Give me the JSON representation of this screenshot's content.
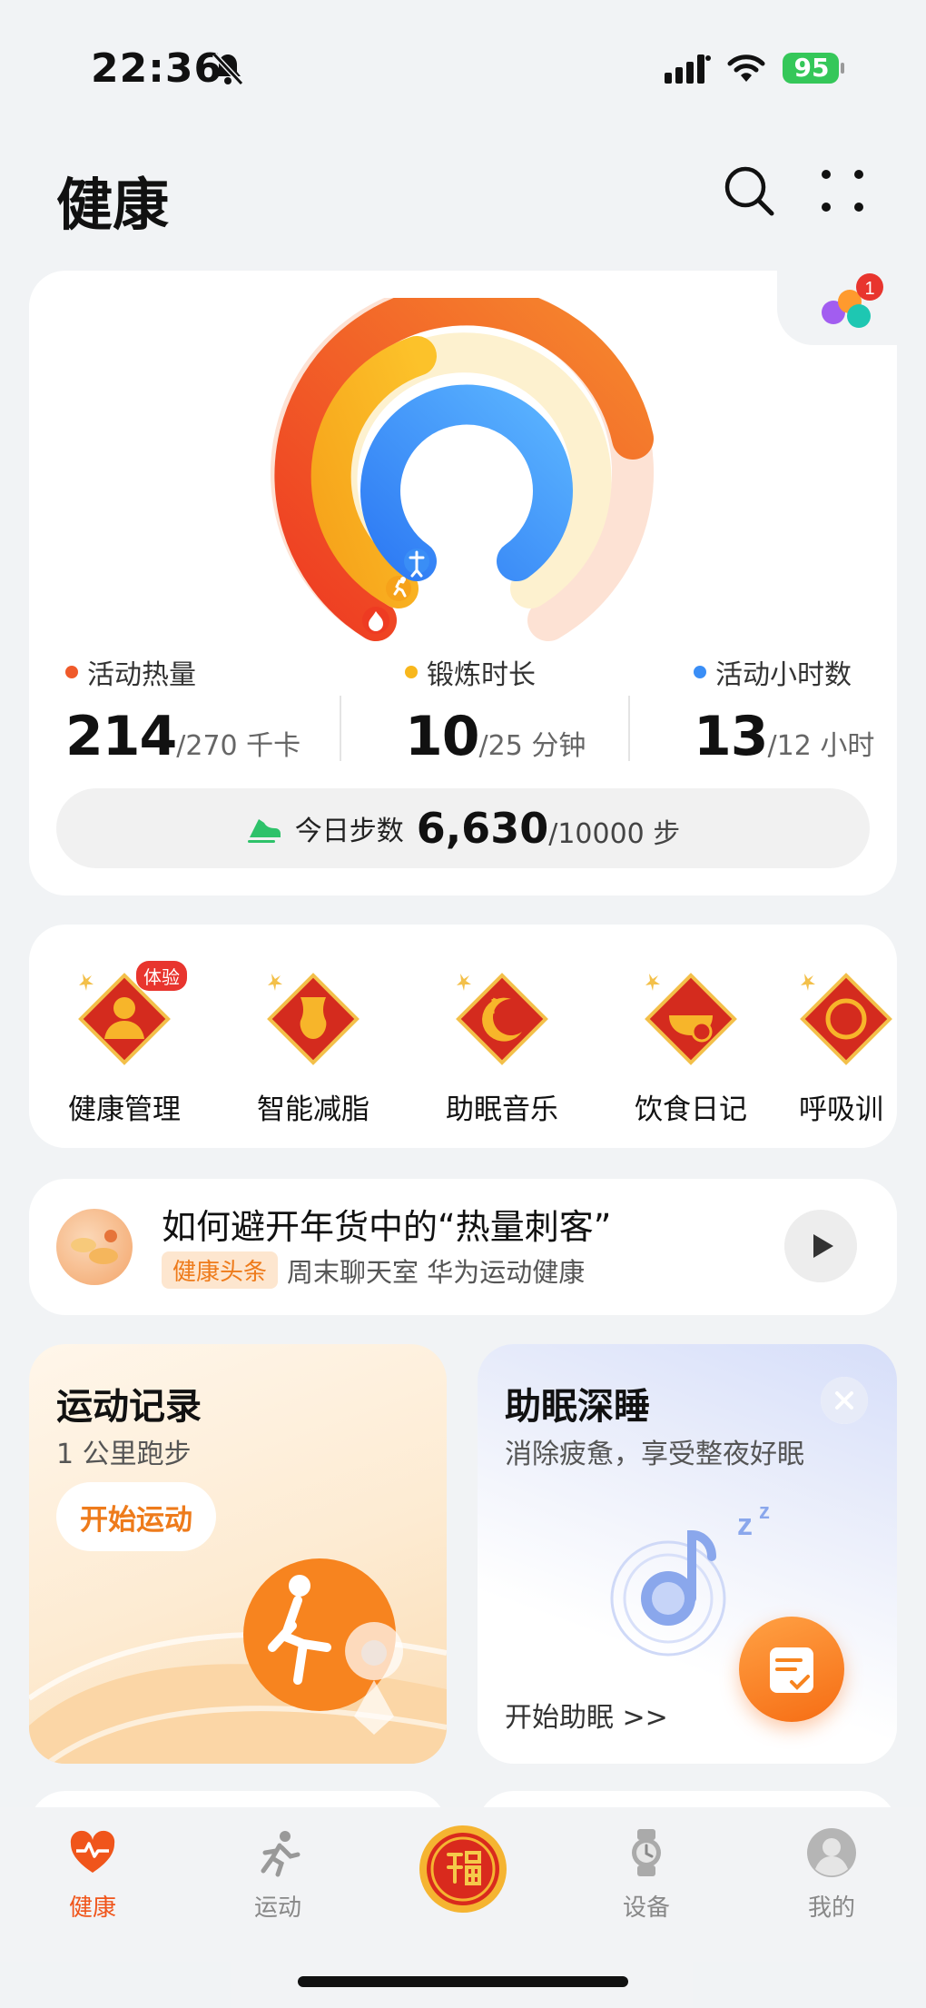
{
  "status": {
    "time": "22:36",
    "battery": "95"
  },
  "header": {
    "title": "健康",
    "search_icon": "search-icon",
    "more_icon": "more-icon"
  },
  "activity": {
    "corner_badge": "1",
    "metrics": [
      {
        "label": "活动热量",
        "value": "214",
        "target": "/270 千卡",
        "color": "#f05a2a"
      },
      {
        "label": "锻炼时长",
        "value": "10",
        "target": "/25 分钟",
        "color": "#f8b71c"
      },
      {
        "label": "活动小时数",
        "value": "13",
        "target": "/12 小时",
        "color": "#3a8ef6"
      }
    ],
    "steps": {
      "label": "今日步数",
      "value": "6,630",
      "target": "/10000 步"
    }
  },
  "services": {
    "badge": "体验",
    "items": [
      {
        "label": "健康管理",
        "icon": "health-management-icon"
      },
      {
        "label": "智能减脂",
        "icon": "fat-loss-icon"
      },
      {
        "label": "助眠音乐",
        "icon": "sleep-music-icon"
      },
      {
        "label": "饮食日记",
        "icon": "diet-diary-icon"
      },
      {
        "label": "呼吸训",
        "icon": "breathing-icon"
      }
    ]
  },
  "news": {
    "title": "如何避开年货中的“热量刺客”",
    "tag": "健康头条",
    "source": "周末聊天室 华为运动健康"
  },
  "run_card": {
    "title": "运动记录",
    "subtitle": "1 公里跑步",
    "button": "开始运动"
  },
  "sleep_card": {
    "title": "助眠深睡",
    "subtitle": "消除疲惫，享受整夜好眠",
    "link": "开始助眠 >>"
  },
  "tabs": [
    {
      "label": "健康",
      "icon": "heart-pulse-icon",
      "active": true
    },
    {
      "label": "运动",
      "icon": "running-icon",
      "active": false
    },
    {
      "label": "设备",
      "icon": "watch-icon",
      "active": false
    },
    {
      "label": "我的",
      "icon": "avatar-icon",
      "active": false
    }
  ],
  "colors": {
    "accent": "#f0551b",
    "calories": "#f05a2a",
    "exercise": "#f8b71c",
    "hours": "#3a8ef6"
  }
}
